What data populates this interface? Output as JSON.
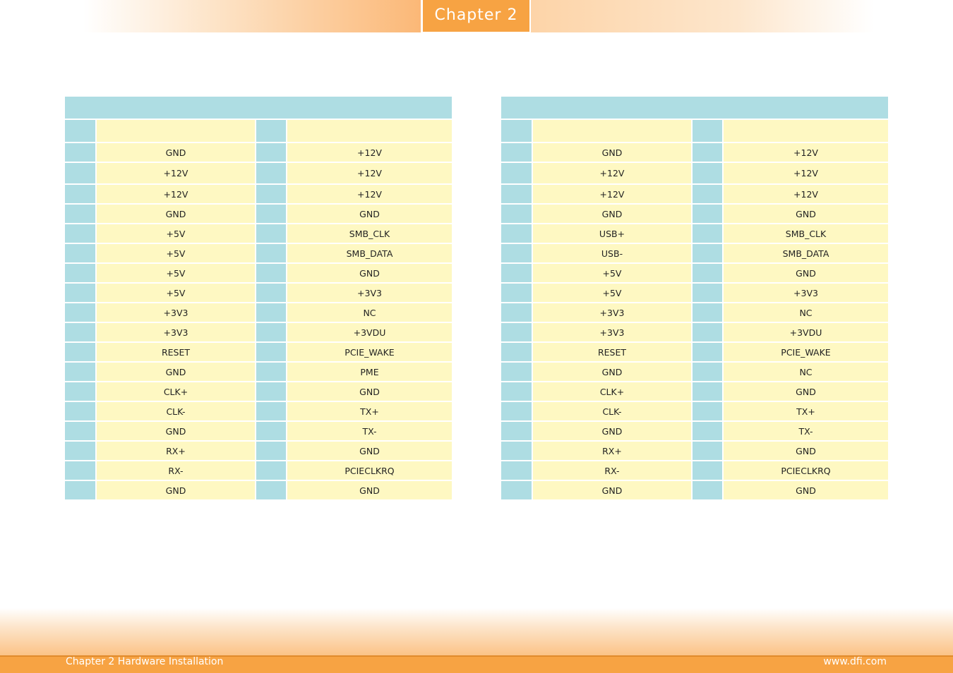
{
  "header": {
    "chapter_label": "Chapter 2"
  },
  "tables": [
    {
      "title": "",
      "headers": [
        "",
        "",
        "",
        ""
      ],
      "rows": [
        [
          "",
          "GND",
          "",
          "+12V"
        ],
        [
          "",
          "+12V",
          "",
          "+12V"
        ],
        [
          "",
          "+12V",
          "",
          "+12V"
        ],
        [
          "",
          "GND",
          "",
          "GND"
        ],
        [
          "",
          "+5V",
          "",
          "SMB_CLK"
        ],
        [
          "",
          "+5V",
          "",
          "SMB_DATA"
        ],
        [
          "",
          "+5V",
          "",
          "GND"
        ],
        [
          "",
          "+5V",
          "",
          "+3V3"
        ],
        [
          "",
          "+3V3",
          "",
          "NC"
        ],
        [
          "",
          "+3V3",
          "",
          "+3VDU"
        ],
        [
          "",
          "RESET",
          "",
          "PCIE_WAKE"
        ],
        [
          "",
          "GND",
          "",
          "PME"
        ],
        [
          "",
          "CLK+",
          "",
          "GND"
        ],
        [
          "",
          "CLK-",
          "",
          "TX+"
        ],
        [
          "",
          "GND",
          "",
          "TX-"
        ],
        [
          "",
          "RX+",
          "",
          "GND"
        ],
        [
          "",
          "RX-",
          "",
          "PCIECLKRQ"
        ],
        [
          "",
          "GND",
          "",
          "GND"
        ]
      ]
    },
    {
      "title": "",
      "headers": [
        "",
        "",
        "",
        ""
      ],
      "rows": [
        [
          "",
          "GND",
          "",
          "+12V"
        ],
        [
          "",
          "+12V",
          "",
          "+12V"
        ],
        [
          "",
          "+12V",
          "",
          "+12V"
        ],
        [
          "",
          "GND",
          "",
          "GND"
        ],
        [
          "",
          "USB+",
          "",
          "SMB_CLK"
        ],
        [
          "",
          "USB-",
          "",
          "SMB_DATA"
        ],
        [
          "",
          "+5V",
          "",
          "GND"
        ],
        [
          "",
          "+5V",
          "",
          "+3V3"
        ],
        [
          "",
          "+3V3",
          "",
          "NC"
        ],
        [
          "",
          "+3V3",
          "",
          "+3VDU"
        ],
        [
          "",
          "RESET",
          "",
          "PCIE_WAKE"
        ],
        [
          "",
          "GND",
          "",
          "NC"
        ],
        [
          "",
          "CLK+",
          "",
          "GND"
        ],
        [
          "",
          "CLK-",
          "",
          "TX+"
        ],
        [
          "",
          "GND",
          "",
          "TX-"
        ],
        [
          "",
          "RX+",
          "",
          "GND"
        ],
        [
          "",
          "RX-",
          "",
          "PCIECLKRQ"
        ],
        [
          "",
          "GND",
          "",
          "GND"
        ]
      ]
    }
  ],
  "footer": {
    "left_text": "Chapter 2 Hardware Installation",
    "right_text": "www.dfi.com"
  },
  "colors": {
    "accent_orange": "#f7a343",
    "pin_cell": "#aedde3",
    "signal_cell": "#fef8c2"
  }
}
